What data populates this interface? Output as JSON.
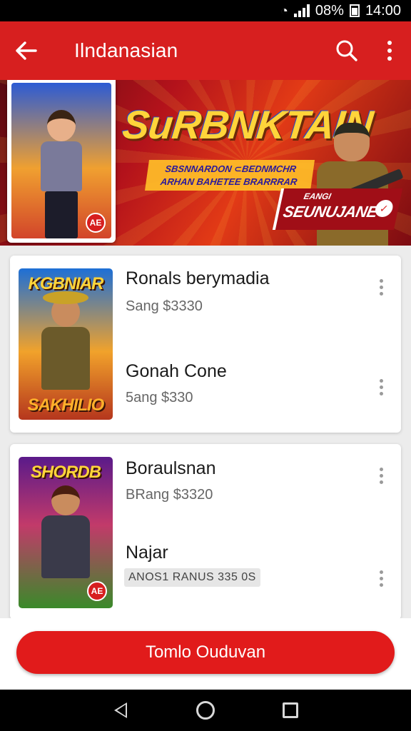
{
  "status_bar": {
    "battery": "08%",
    "time": "14:00"
  },
  "app_bar": {
    "back_icon": "arrow-left-icon",
    "title": "Ilndanasian",
    "search_icon": "search-icon",
    "menu_icon": "more-vertical-icon"
  },
  "banner": {
    "title": "SuRBNKTAIN",
    "subtitle": "SBSNNARDON ⊂BEDNMCHR ARHAN BAHETEE BRARRRAR",
    "tag_small": "EANGI",
    "tag_big": "SEUNUJANE",
    "card_badge": "AE"
  },
  "items": [
    {
      "thumb_title": "KGBNIAR",
      "thumb_bottom": "SAKHILIO",
      "title": "Ronals berymadia",
      "subtitle": "Sang $3330",
      "badge": ""
    },
    {
      "thumb_title": "",
      "thumb_bottom": "",
      "title": "Gonah Cone",
      "subtitle": "5ang $330",
      "badge": ""
    },
    {
      "thumb_title": "SHORDB",
      "thumb_bottom": "",
      "title": "Boraulsnan",
      "subtitle": "BRang $3320",
      "badge": "AE"
    },
    {
      "thumb_title": "",
      "thumb_bottom": "",
      "title": "Najar",
      "subtitle": "",
      "chip": "ANOS1 RANUS 335 0S"
    }
  ],
  "cta": {
    "label": "Tomlo Ouduvan"
  },
  "colors": {
    "primary": "#d71f1f",
    "cta": "#e11b1b"
  }
}
